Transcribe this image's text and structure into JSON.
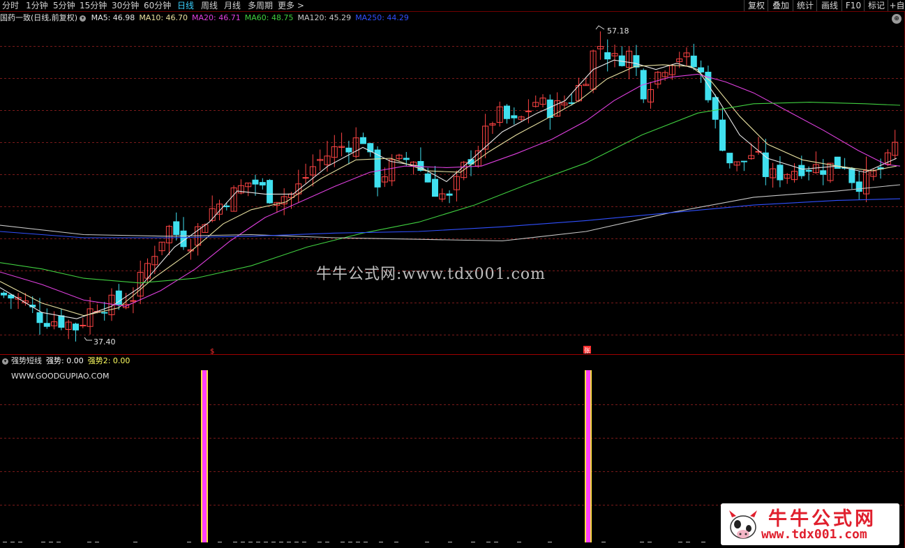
{
  "toolbar": {
    "periods": [
      "分时",
      "1分钟",
      "5分钟",
      "15分钟",
      "30分钟",
      "60分钟",
      "日线",
      "周线",
      "月线",
      "多周期",
      "更多 >"
    ],
    "active_period": "日线",
    "tools": [
      "复权",
      "叠加",
      "统计",
      "画线",
      "F10",
      "标记",
      "+自"
    ]
  },
  "main_legend": {
    "title": "国药一致(日线,前复权)",
    "ma": [
      {
        "label": "MA5: 46.98",
        "color": "#e8e8e8"
      },
      {
        "label": "MA10: 46.70",
        "color": "#e8e0a0"
      },
      {
        "label": "MA20: 46.71",
        "color": "#e040e0"
      },
      {
        "label": "MA60: 48.75",
        "color": "#40d040"
      },
      {
        "label": "MA120: 45.29",
        "color": "#c8c8c8"
      },
      {
        "label": "MA250: 44.29",
        "color": "#3050ff"
      }
    ]
  },
  "price_labels": {
    "high": "57.18",
    "low": "37.40"
  },
  "markers": {
    "signal_a": "$",
    "signal_b": "张"
  },
  "sub_legend": {
    "name": "强势短线",
    "values": [
      {
        "label": "强势: 0.00",
        "color": "#ffffff"
      },
      {
        "label": "强势2: 0.00",
        "color": "#ffff60"
      }
    ]
  },
  "website": "WWW.GOODGUPIAO.COM",
  "watermark": "牛牛公式网:www.tdx001.com",
  "logo": {
    "name": "牛牛公式网",
    "url": "www.tdx001.com"
  },
  "colors": {
    "up": "#ff4444",
    "down": "#40e0ef",
    "grid": "#7a1a1a",
    "ma5": "#e8e8e8",
    "ma10": "#e8e0a0",
    "ma20": "#e040e0",
    "ma60": "#40d040",
    "ma120": "#c8c8c8",
    "ma250": "#3050ff"
  }
}
